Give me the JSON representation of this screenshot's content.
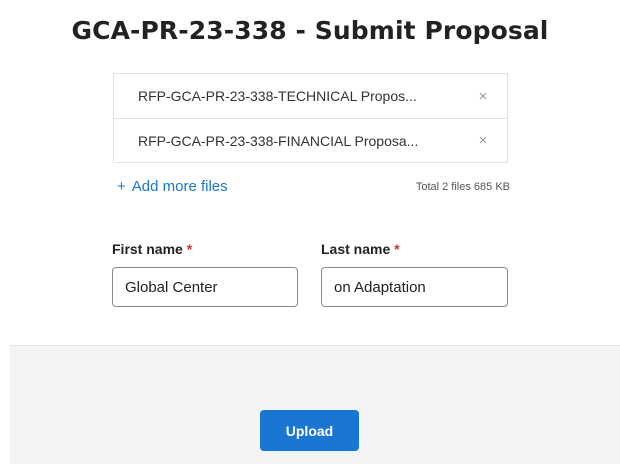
{
  "page": {
    "title": "GCA-PR-23-338 - Submit Proposal"
  },
  "files": {
    "items": [
      {
        "name": "RFP-GCA-PR-23-338-TECHNICAL Propos...",
        "remove_icon": "×"
      },
      {
        "name": "RFP-GCA-PR-23-338-FINANCIAL Proposa...",
        "remove_icon": "×"
      }
    ],
    "add_more_icon": "+",
    "add_more_label": "Add more files",
    "total": "Total 2 files 685 KB"
  },
  "form": {
    "first_name": {
      "label": "First name",
      "required_mark": "*",
      "value": "Global Center"
    },
    "last_name": {
      "label": "Last name",
      "required_mark": "*",
      "value": "on Adaptation"
    }
  },
  "actions": {
    "upload_label": "Upload"
  },
  "colors": {
    "accent": "#1976d2",
    "required": "#d32f2f",
    "footer_bg": "#f4f4f4"
  }
}
